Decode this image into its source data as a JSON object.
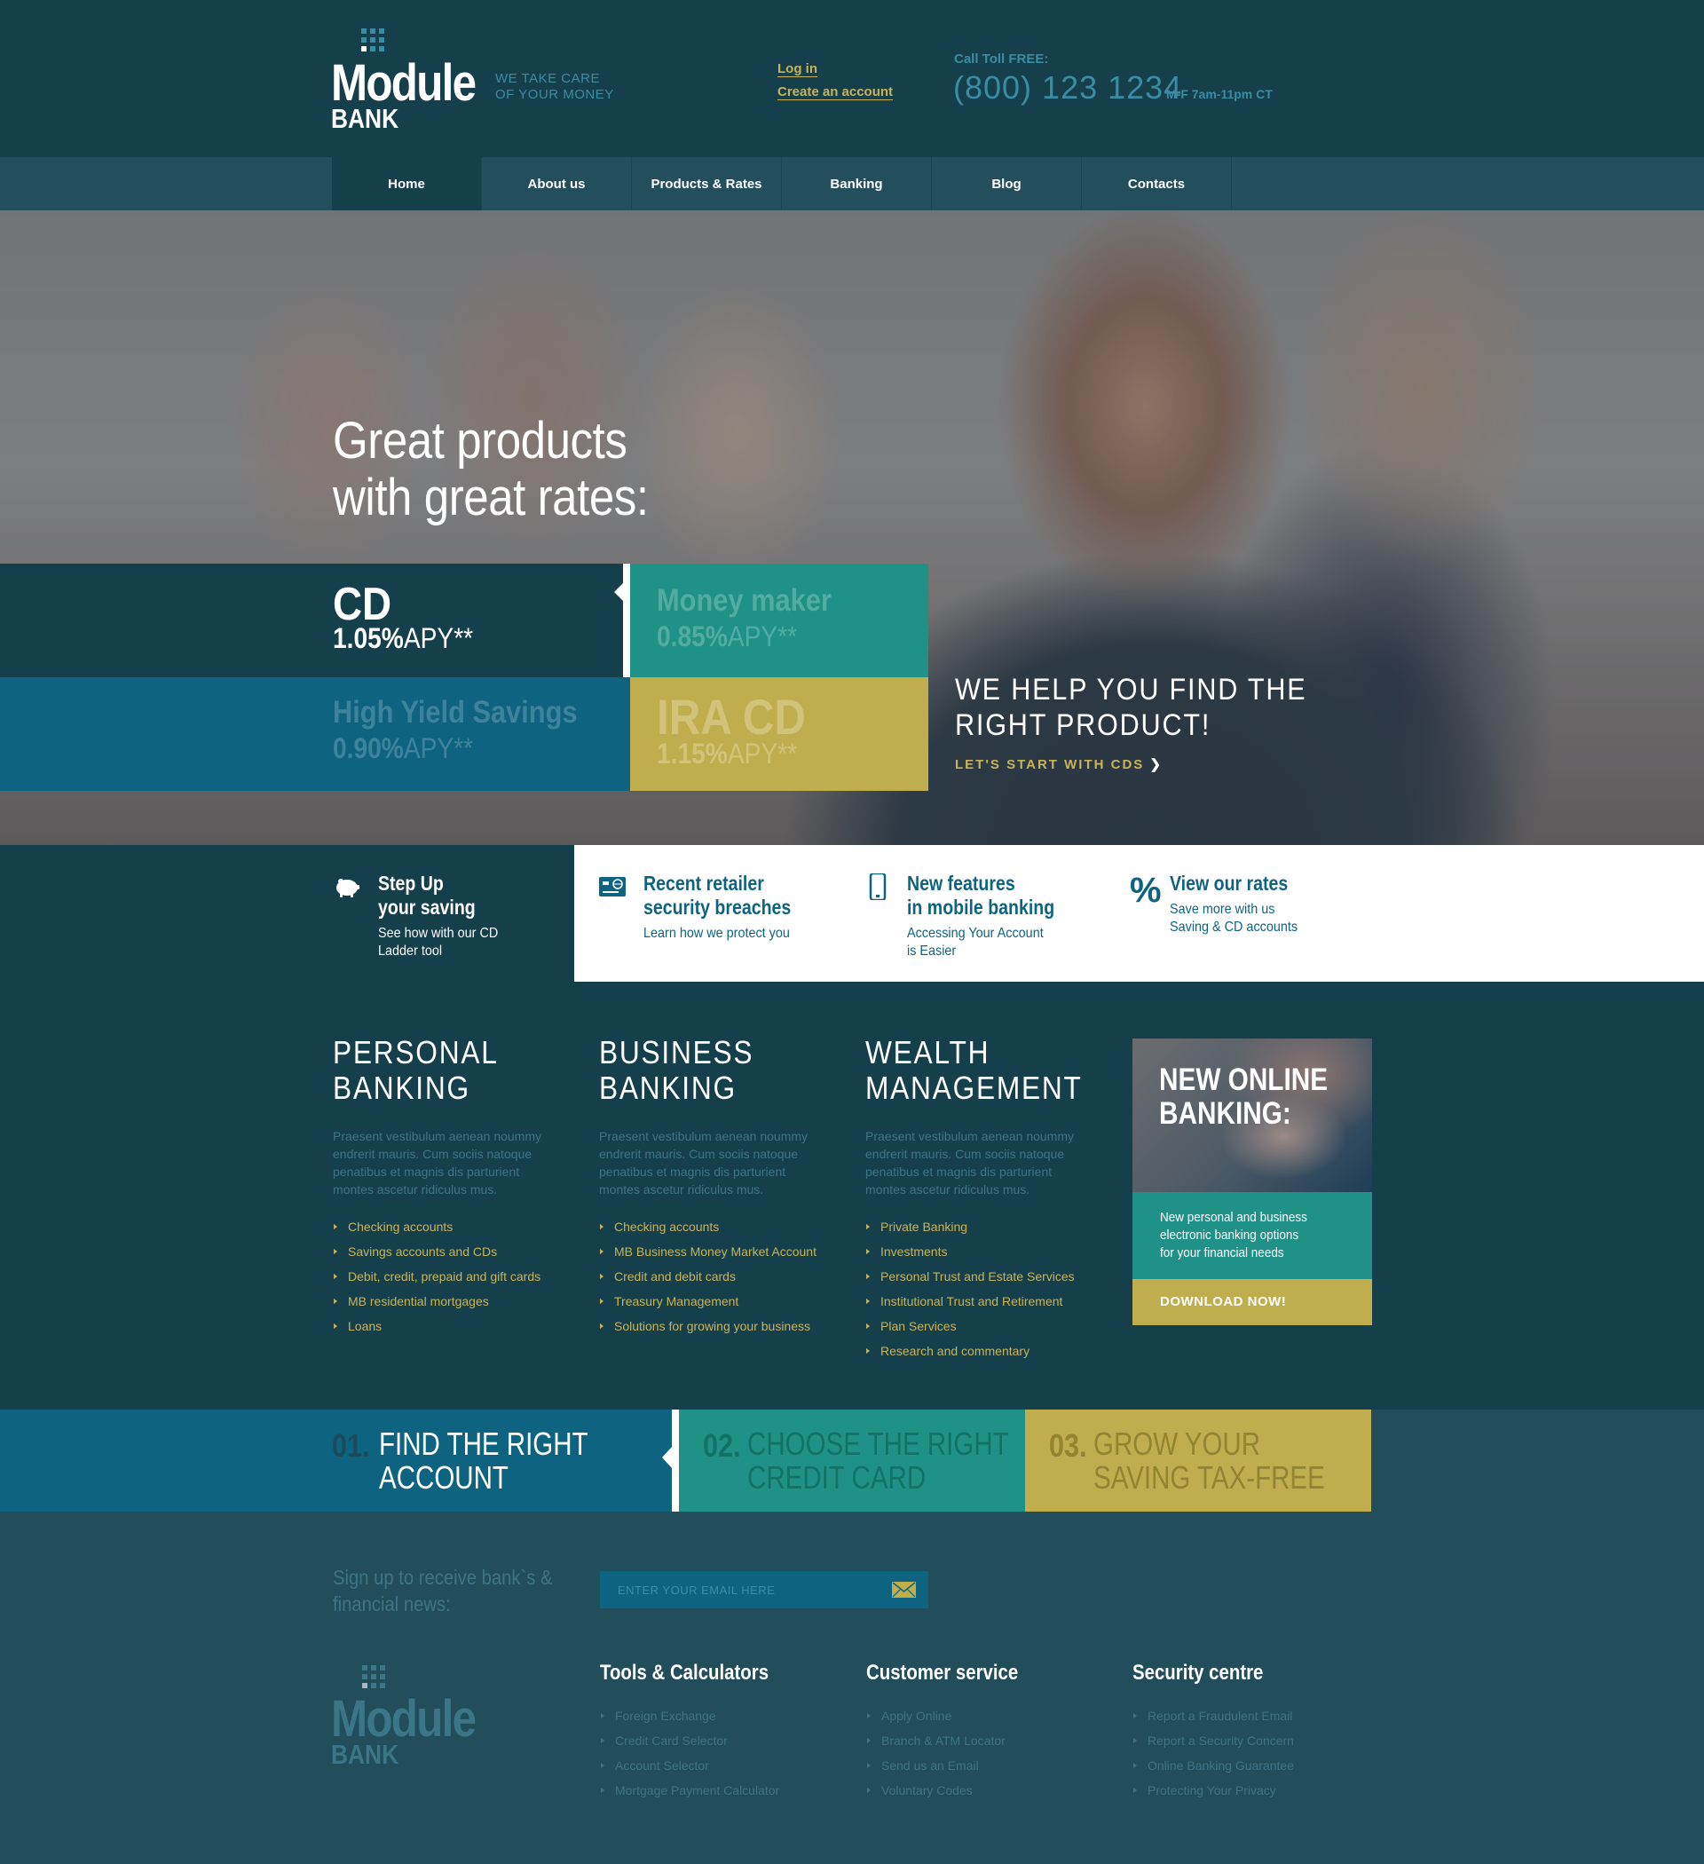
{
  "brand": {
    "name": "Module",
    "sub": "BANK",
    "tagline_line1": "WE TAKE CARE",
    "tagline_line2": "OF YOUR MONEY"
  },
  "header": {
    "login_label": "Log in",
    "create_account_label": "Create an account",
    "call_label": "Call Toll FREE:",
    "phone": "(800) 123 1234",
    "hours": "M-F 7am-11pm CT"
  },
  "nav": {
    "items": [
      {
        "label": "Home",
        "active": true
      },
      {
        "label": "About us"
      },
      {
        "label": "Products & Rates"
      },
      {
        "label": "Banking"
      },
      {
        "label": "Blog"
      },
      {
        "label": "Contacts"
      }
    ]
  },
  "hero": {
    "title_line1": "Great products",
    "title_line2": "with great rates:",
    "rates": [
      {
        "name": "CD",
        "rate": "1.05%",
        "suffix": "APY**",
        "active": true
      },
      {
        "name": "Money maker",
        "rate": "0.85%",
        "suffix": "APY**"
      },
      {
        "name": "High Yield Savings",
        "rate": "0.90%",
        "suffix": "APY**"
      },
      {
        "name": "IRA CD",
        "rate": "1.15%",
        "suffix": "APY**"
      }
    ],
    "help_line1": "WE HELP YOU FIND THE",
    "help_line2": "RIGHT PRODUCT!",
    "help_link": "LET'S START WITH CDS",
    "help_link_icon": "chevron-right-icon"
  },
  "features": [
    {
      "icon": "piggy-bank-icon",
      "title_line1": "Step Up",
      "title_line2": "your saving",
      "desc_line1": "See how with our CD",
      "desc_line2": "Ladder tool"
    },
    {
      "icon": "credit-card-globe-icon",
      "title_line1": "Recent retailer",
      "title_line2": "security breaches",
      "desc_line1": "Learn how we protect you",
      "desc_line2": ""
    },
    {
      "icon": "mobile-phone-icon",
      "title_line1": "New features",
      "title_line2": "in mobile banking",
      "desc_line1": "Accessing Your Account",
      "desc_line2": "is Easier"
    },
    {
      "icon": "percent-icon",
      "title_line1": "View our rates",
      "title_line2": "",
      "desc_line1": "Save more with us",
      "desc_line2": "Saving & CD accounts"
    }
  ],
  "banking": {
    "columns": [
      {
        "title_line1": "PERSONAL",
        "title_line2": "BANKING",
        "desc": [
          "Praesent vestibulum aenean noummy",
          "endrerit mauris. Cum sociis natoque",
          "penatibus et magnis dis parturient",
          "montes ascetur ridiculus mus."
        ],
        "links": [
          "Checking accounts",
          "Savings accounts and CDs",
          "Debit, credit, prepaid and gift cards",
          "MB residential mortgages",
          "Loans"
        ]
      },
      {
        "title_line1": "BUSINESS",
        "title_line2": "BANKING",
        "desc": [
          "Praesent vestibulum aenean noummy",
          "endrerit mauris. Cum sociis natoque",
          "penatibus et magnis dis parturient",
          "montes ascetur ridiculus mus."
        ],
        "links": [
          "Checking accounts",
          "MB Business Money Market Account",
          "Credit and debit cards",
          "Treasury Management",
          "Solutions for growing your business"
        ]
      },
      {
        "title_line1": "WEALTH",
        "title_line2": "MANAGEMENT",
        "desc": [
          "Praesent vestibulum aenean noummy",
          "endrerit mauris. Cum sociis natoque",
          "penatibus et magnis dis parturient",
          "montes ascetur ridiculus mus."
        ],
        "links": [
          "Private Banking",
          "Investments",
          "Personal Trust and Estate Services",
          "Institutional Trust and Retirement",
          "Plan Services",
          "Research and commentary"
        ]
      }
    ],
    "promo": {
      "title_line1": "NEW ONLINE",
      "title_line2": "BANKING:",
      "text_line1": "New personal and business",
      "text_line2": "electronic banking options",
      "text_line3": "for your financial needs",
      "button": "DOWNLOAD NOW!"
    }
  },
  "steps": [
    {
      "num": "01.",
      "line1": "FIND THE RIGHT",
      "line2": "ACCOUNT",
      "active": true
    },
    {
      "num": "02.",
      "line1": "CHOOSE THE RIGHT",
      "line2": "CREDIT CARD"
    },
    {
      "num": "03.",
      "line1": "GROW YOUR",
      "line2": "SAVING TAX-FREE"
    }
  ],
  "footer": {
    "signup_line1": "Sign up to receive bank`s &",
    "signup_line2": "financial news:",
    "email_placeholder": "ENTER YOUR EMAIL HERE",
    "columns": [
      {
        "title": "Tools & Calculators",
        "links": [
          "Foreign Exchange",
          "Credit Card Selector",
          "Account Selector",
          "Mortgage Payment Calculator"
        ]
      },
      {
        "title": "Customer service",
        "links": [
          "Apply Online",
          "Branch & ATM Locator",
          "Send us an Email",
          "Voluntary Codes"
        ]
      },
      {
        "title": "Security centre",
        "links": [
          "Report a Fraudulent Email",
          "Report a Security Concern",
          "Online Banking Guarantee",
          "Protecting Your Privacy"
        ]
      }
    ]
  },
  "colors": {
    "dark_navy": "#163f4c",
    "footer_bg": "#224d5a",
    "blue": "#0e6480",
    "teal": "#1f9187",
    "gold": "#c0ae4e",
    "link_gold": "#c7b45a",
    "muted_blue": "#3a8ca3"
  }
}
